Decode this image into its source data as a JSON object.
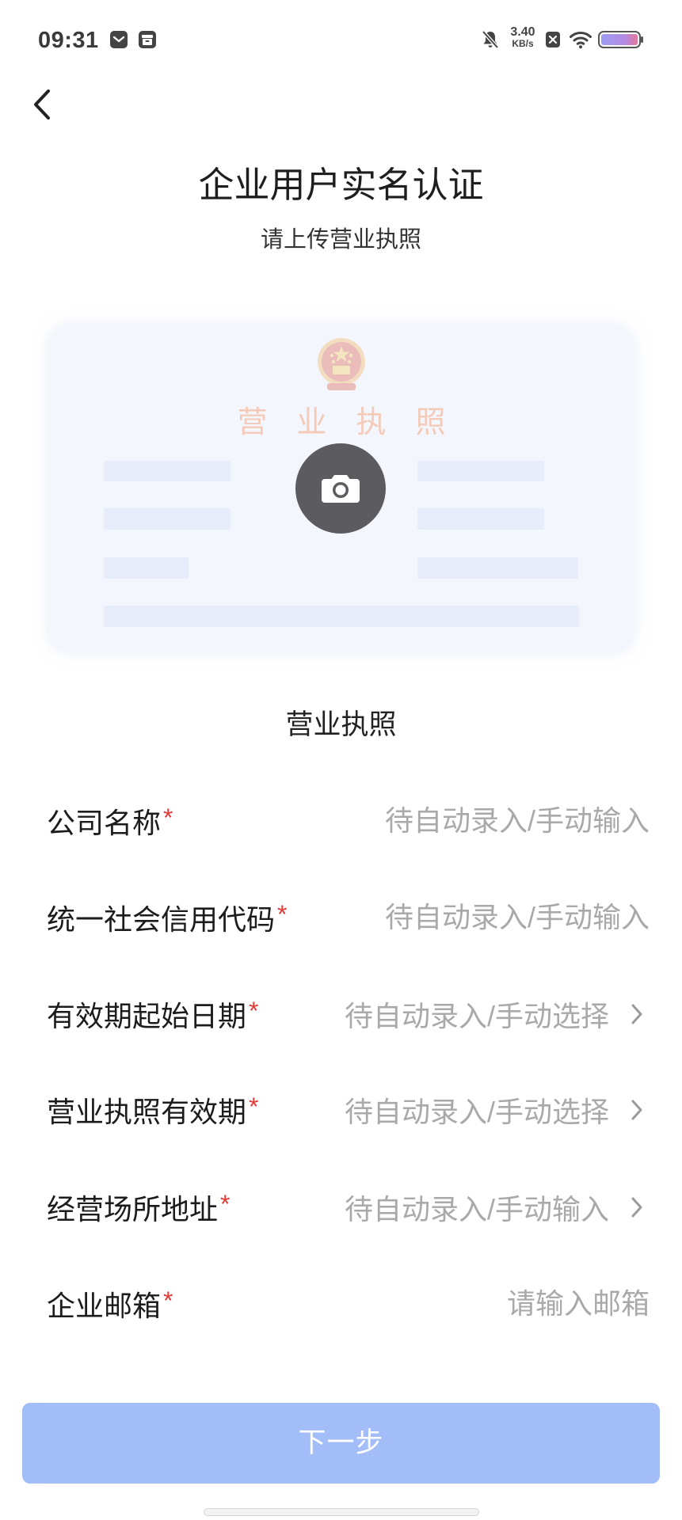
{
  "status_bar": {
    "time": "09:31",
    "net_speed": {
      "value": "3.40",
      "unit": "KB/s"
    },
    "left_icons": [
      "message-icon",
      "archive-icon"
    ],
    "right_icons": [
      "bell-off-icon",
      "close-box-icon",
      "wifi-icon",
      "battery-icon"
    ]
  },
  "nav": {
    "back_icon": "chevron-left-icon"
  },
  "header": {
    "title": "企业用户实名认证",
    "subtitle": "请上传营业执照"
  },
  "upload": {
    "sample_card_title": "营业执照",
    "emblem_icon": "national-emblem-icon",
    "upload_icon": "camera-icon",
    "caption": "营业执照"
  },
  "form": {
    "rows": [
      {
        "label": "公司名称",
        "required_mark": "*",
        "placeholder": "待自动录入/手动输入"
      },
      {
        "label": "统一社会信用代码",
        "required_mark": "*",
        "placeholder": "待自动录入/手动输入"
      },
      {
        "label": "有效期起始日期",
        "required_mark": "*",
        "placeholder": "待自动录入/手动选择",
        "action_icon": "chevron-right-icon"
      },
      {
        "label": "营业执照有效期",
        "required_mark": "*",
        "placeholder": "待自动录入/手动选择",
        "action_icon": "chevron-right-icon"
      },
      {
        "label": "经营场所地址",
        "required_mark": "*",
        "placeholder": "待自动录入/手动输入",
        "action_icon": "chevron-right-icon"
      },
      {
        "label": "企业邮箱",
        "required_mark": "*",
        "placeholder": "请输入邮箱"
      }
    ]
  },
  "footer": {
    "next_button_label": "下一步"
  },
  "colors": {
    "primary_button": "#a3bdf8",
    "required_mark": "#e53935",
    "placeholder_text": "#a9a9a9",
    "camera_button": "#5c5c60",
    "sample_card_background": "#f4f6fd"
  }
}
